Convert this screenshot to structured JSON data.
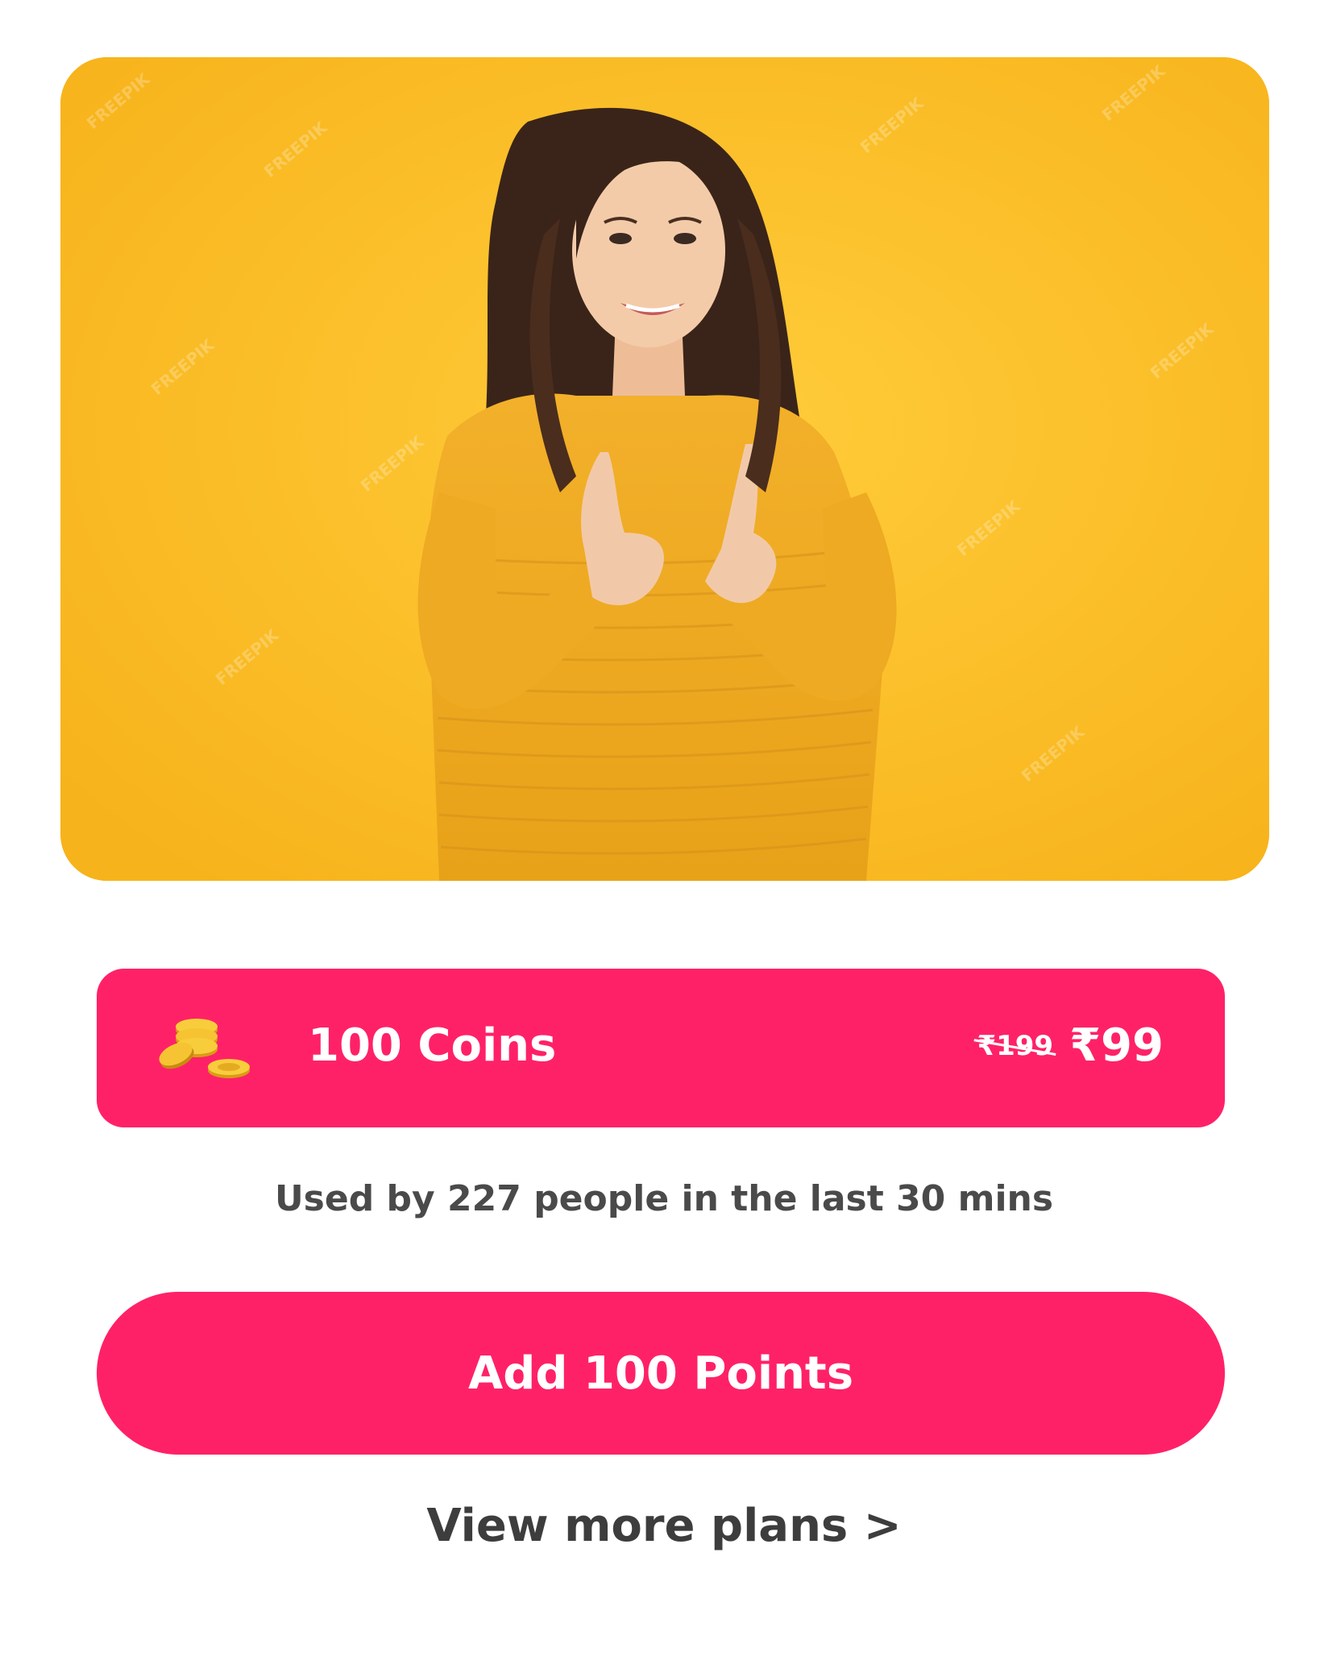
{
  "hero": {
    "image": "smiling-woman-yellow-sweater-pointing",
    "watermark": "FREEPIK",
    "background_color": "#fdbd22"
  },
  "plan": {
    "icon": "gold-coins-icon",
    "title": "100 Coins",
    "original_price": "₹199",
    "price": "₹99",
    "card_color": "#ff2167"
  },
  "usage_note": "Used by 227 people in the last 30 mins",
  "cta": {
    "label": "Add 100 Points",
    "color": "#ff2167"
  },
  "more_plans_link": "View more plans >"
}
